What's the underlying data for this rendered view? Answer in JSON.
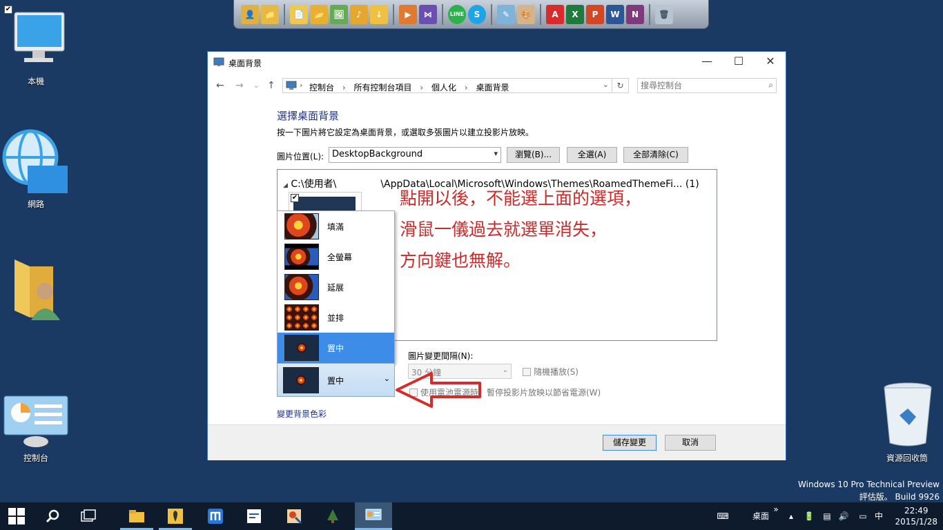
{
  "desktop": {
    "icons": [
      {
        "label": "本機"
      },
      {
        "label": "網路"
      },
      {
        "label": ""
      },
      {
        "label": "控制台"
      },
      {
        "label": "資源回收筒"
      }
    ],
    "checkmark": "✔"
  },
  "dock": {
    "icons": [
      "user-folder-icon",
      "folder-pin-icon",
      "documents-icon",
      "folder-icon",
      "pictures-icon",
      "music-icon",
      "downloads-icon",
      "video-icon",
      "visual-studio-icon",
      "line-icon",
      "skype-icon",
      "notepad-icon",
      "paint-icon",
      "pdf-icon",
      "excel-icon",
      "powerpoint-icon",
      "word-icon",
      "onenote-icon",
      "recycle-icon"
    ],
    "glyphs": {
      "line": "LINE",
      "skype": "S",
      "pdf": "A",
      "excel": "X",
      "powerpoint": "P",
      "word": "W",
      "onenote": "N"
    }
  },
  "window": {
    "title": "桌面背景",
    "buttons": {
      "minimize": "—",
      "maximize": "☐",
      "close": "✕"
    },
    "address": {
      "crumbs": [
        "控制台",
        "所有控制台項目",
        "個人化",
        "桌面背景"
      ],
      "separator": "›"
    },
    "search": {
      "placeholder": "搜尋控制台"
    },
    "heading": "選擇桌面背景",
    "subtext": "按一下圖片將它設定為桌面背景，或選取多張圖片以建立投影片放映。",
    "location": {
      "label": "圖片位置(L):",
      "value": "DesktopBackground"
    },
    "buttons_row": {
      "browse": "瀏覽(B)...",
      "select_all": "全選(A)",
      "clear_all": "全部清除(C)"
    },
    "panel": {
      "path_user": "C:\\使用者\\",
      "path_rest": "\\AppData\\Local\\Microsoft\\Windows\\Themes\\RoamedThemeFi... (1)",
      "thumb_checked": "✔"
    },
    "annotation": [
      "點開以後，不能選上面的選項，",
      "滑鼠一儀過去就選單消失，",
      "方向鍵也無解。"
    ],
    "position_dropdown": {
      "options": [
        "填滿",
        "全螢幕",
        "延展",
        "並排",
        "置中"
      ],
      "selected_index": 4,
      "current": "置中"
    },
    "interval": {
      "label": "圖片變更間隔(N):",
      "value": "30 分鐘"
    },
    "shuffle": "隨機播放(S)",
    "battery": "使用電池電源時，暫停投影片放映以節省電源(W)",
    "change_color": "變更背景色彩",
    "footer": {
      "save": "儲存變更",
      "cancel": "取消"
    }
  },
  "watermark": {
    "line1": "Windows 10 Pro Technical Preview",
    "line2": "評估版。 Build 9926"
  },
  "taskbar": {
    "tray": {
      "desktop_label": "桌面",
      "chevron": "»",
      "ime": "中"
    },
    "clock": {
      "time": "22:49",
      "date": "2015/1/28"
    }
  },
  "colors": {
    "desktop_bg": "#1b3a63",
    "accent": "#3c8ce8",
    "annotation_red": "#cc2a2a",
    "link_blue": "#1e3287"
  }
}
